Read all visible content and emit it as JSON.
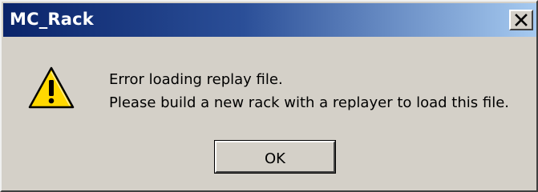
{
  "window": {
    "title": "MC_Rack"
  },
  "titlebar": {
    "close_icon": "close-icon"
  },
  "dialog": {
    "icon": "warning-icon",
    "message_line1": "Error loading replay file.",
    "message_line2": "Please build a new rack with a replayer to load this file.",
    "ok_label": "OK"
  },
  "colors": {
    "titlebar_start": "#0a246a",
    "titlebar_end": "#a6caf0",
    "face": "#d4d0c8",
    "warning_fill": "#ffd800"
  }
}
